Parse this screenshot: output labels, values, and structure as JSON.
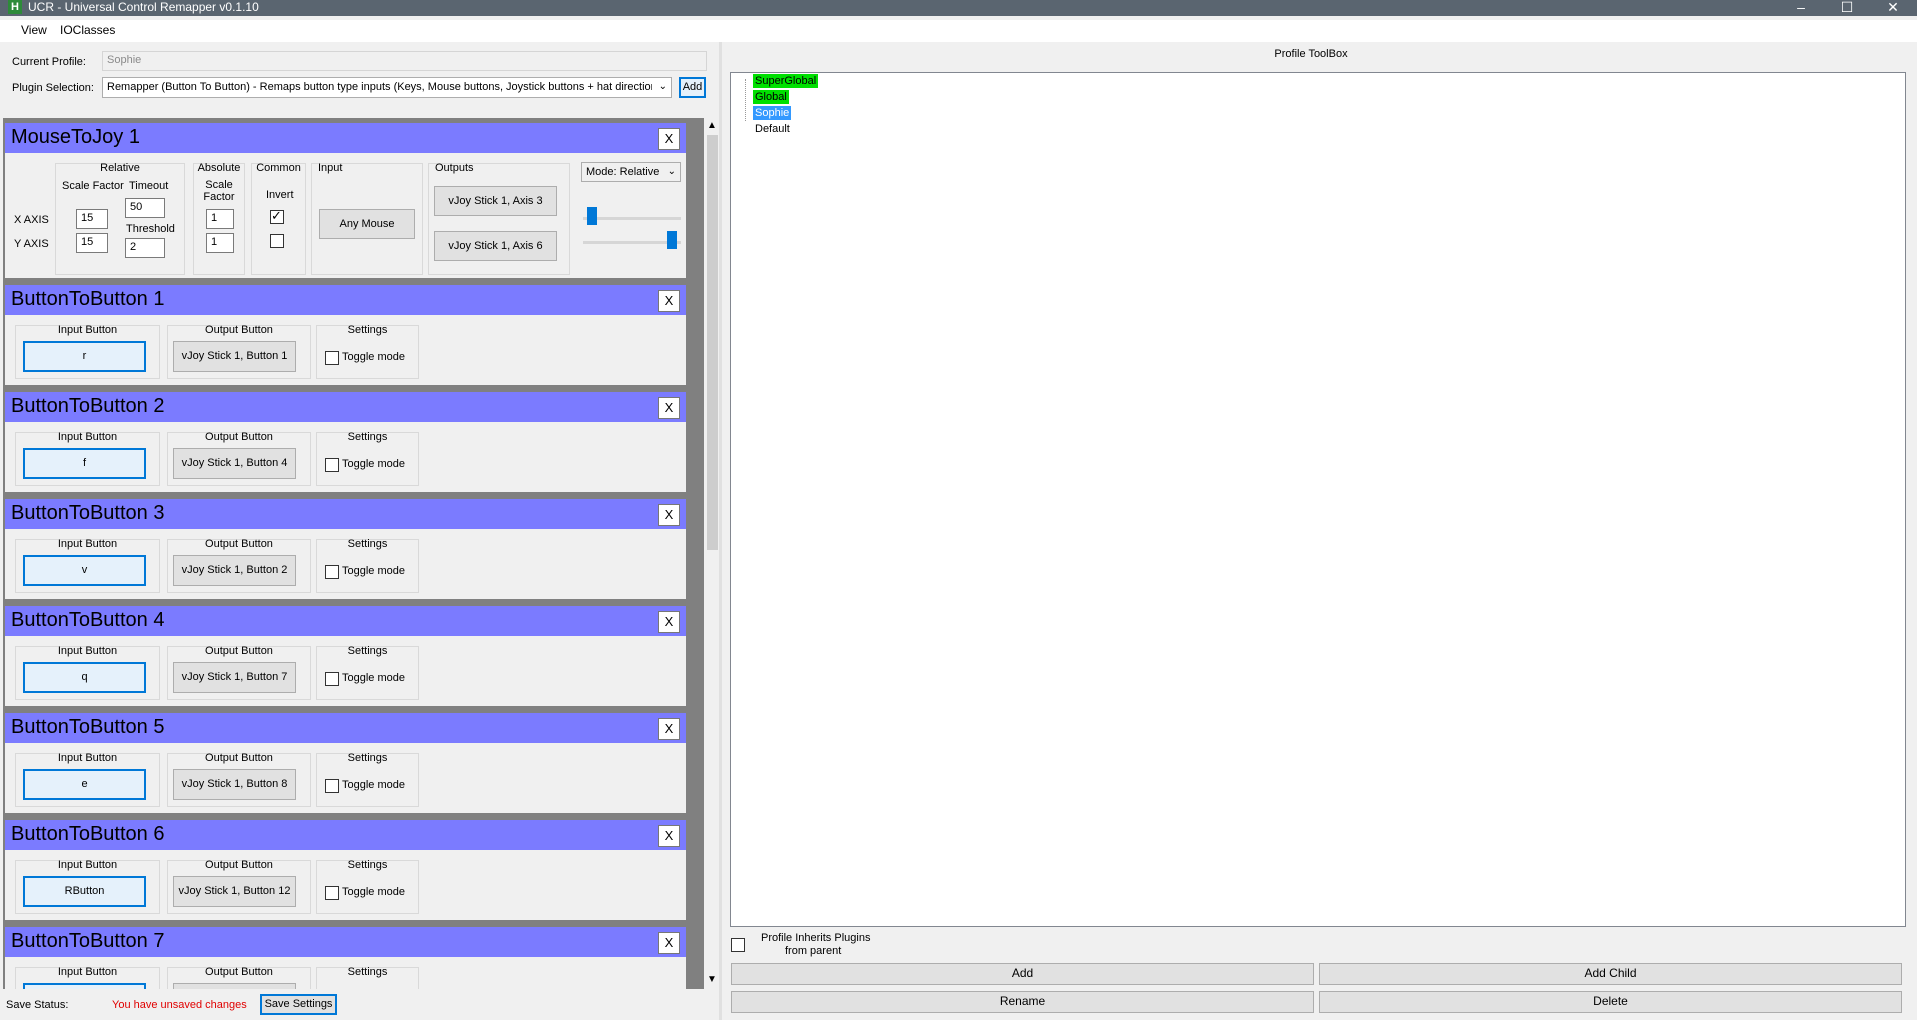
{
  "window": {
    "title": "UCR - Universal Control Remapper v0.1.10",
    "app_icon_letter": "H",
    "minimize": "–",
    "maximize": "☐",
    "close": "✕"
  },
  "menu": {
    "items": [
      "View",
      "IOClasses"
    ]
  },
  "profile": {
    "current_label": "Current Profile:",
    "current_value": "Sophie",
    "plugin_label": "Plugin Selection:",
    "plugin_value": "Remapper (Button To Button)    - Remaps button type inputs (Keys, Mouse buttons, Joystick buttons + hat directions)",
    "add_label": "Add"
  },
  "mouse_to_joy": {
    "title": "MouseToJoy 1",
    "close": "X",
    "relative_title": "Relative",
    "scale_factor_label": "Scale Factor",
    "timeout_label": "Timeout",
    "threshold_label": "Threshold",
    "x_axis_label": "X AXIS",
    "y_axis_label": "Y AXIS",
    "x_scale": "15",
    "y_scale": "15",
    "timeout": "50",
    "threshold": "2",
    "absolute_title": "Absolute",
    "abs_scale_label": "Scale Factor",
    "abs_x": "1",
    "abs_y": "1",
    "common_title": "Common",
    "invert_label": "Invert",
    "invert_x": true,
    "invert_y": false,
    "input_title": "Input",
    "input_value": "Any Mouse",
    "outputs_title": "Outputs",
    "output_x": "vJoy Stick 1, Axis 3",
    "output_y": "vJoy Stick 1, Axis 6",
    "mode": "Mode: Relative",
    "slider_top": 0.05,
    "slider_bottom": 0.95
  },
  "button_labels": {
    "input": "Input Button",
    "output": "Output Button",
    "settings": "Settings",
    "toggle": "Toggle mode",
    "close": "X"
  },
  "buttons": [
    {
      "title": "ButtonToButton 1",
      "input": "r",
      "output": "vJoy Stick 1, Button 1"
    },
    {
      "title": "ButtonToButton 2",
      "input": "f",
      "output": "vJoy Stick 1, Button 4"
    },
    {
      "title": "ButtonToButton 3",
      "input": "v",
      "output": "vJoy Stick 1, Button 2"
    },
    {
      "title": "ButtonToButton 4",
      "input": "q",
      "output": "vJoy Stick 1, Button 7"
    },
    {
      "title": "ButtonToButton 5",
      "input": "e",
      "output": "vJoy Stick 1, Button 8"
    },
    {
      "title": "ButtonToButton 6",
      "input": "RButton",
      "output": "vJoy Stick 1, Button 12"
    },
    {
      "title": "ButtonToButton 7",
      "input": "",
      "output": ""
    }
  ],
  "status": {
    "label": "Save Status:",
    "message": "You have unsaved changes",
    "save_button": "Save Settings",
    "message_color": "#e00000"
  },
  "toolbox": {
    "title": "Profile ToolBox",
    "nodes": [
      {
        "label": "SuperGlobal",
        "highlight": "#00e000"
      },
      {
        "label": "Global",
        "highlight": "#00e000"
      },
      {
        "label": "Sophie",
        "highlight": "#3399ff"
      },
      {
        "label": "Default",
        "highlight": ""
      }
    ],
    "inherit_label_line1": "Profile Inherits Plugins",
    "inherit_label_line2": "from parent",
    "add": "Add",
    "add_child": "Add Child",
    "rename": "Rename",
    "delete": "Delete"
  },
  "colors": {
    "plugin_header": "#7b7bff",
    "accent": "#0078d7"
  }
}
